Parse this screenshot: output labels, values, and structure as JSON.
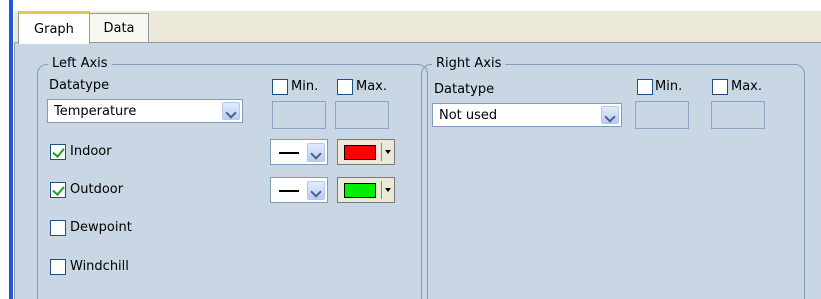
{
  "tabs": [
    {
      "label": "Graph",
      "active": true
    },
    {
      "label": "Data",
      "active": false
    }
  ],
  "left_axis": {
    "title": "Left Axis",
    "datatype_label": "Datatype",
    "datatype_value": "Temperature",
    "min_label": "Min.",
    "min_checked": false,
    "max_label": "Max.",
    "max_checked": false,
    "series": [
      {
        "label": "Indoor",
        "checked": true,
        "line_style": "solid",
        "color": "#ff0000"
      },
      {
        "label": "Outdoor",
        "checked": true,
        "line_style": "solid",
        "color": "#00ee00"
      },
      {
        "label": "Dewpoint",
        "checked": false
      },
      {
        "label": "Windchill",
        "checked": false
      }
    ]
  },
  "right_axis": {
    "title": "Right Axis",
    "datatype_label": "Datatype",
    "datatype_value": "Not used",
    "min_label": "Min.",
    "min_checked": false,
    "max_label": "Max.",
    "max_checked": false
  },
  "colors": {
    "panel_bg": "#c9d6e4",
    "tab_highlight": "#f0c050",
    "accent_bar": "#1f5ad6"
  }
}
